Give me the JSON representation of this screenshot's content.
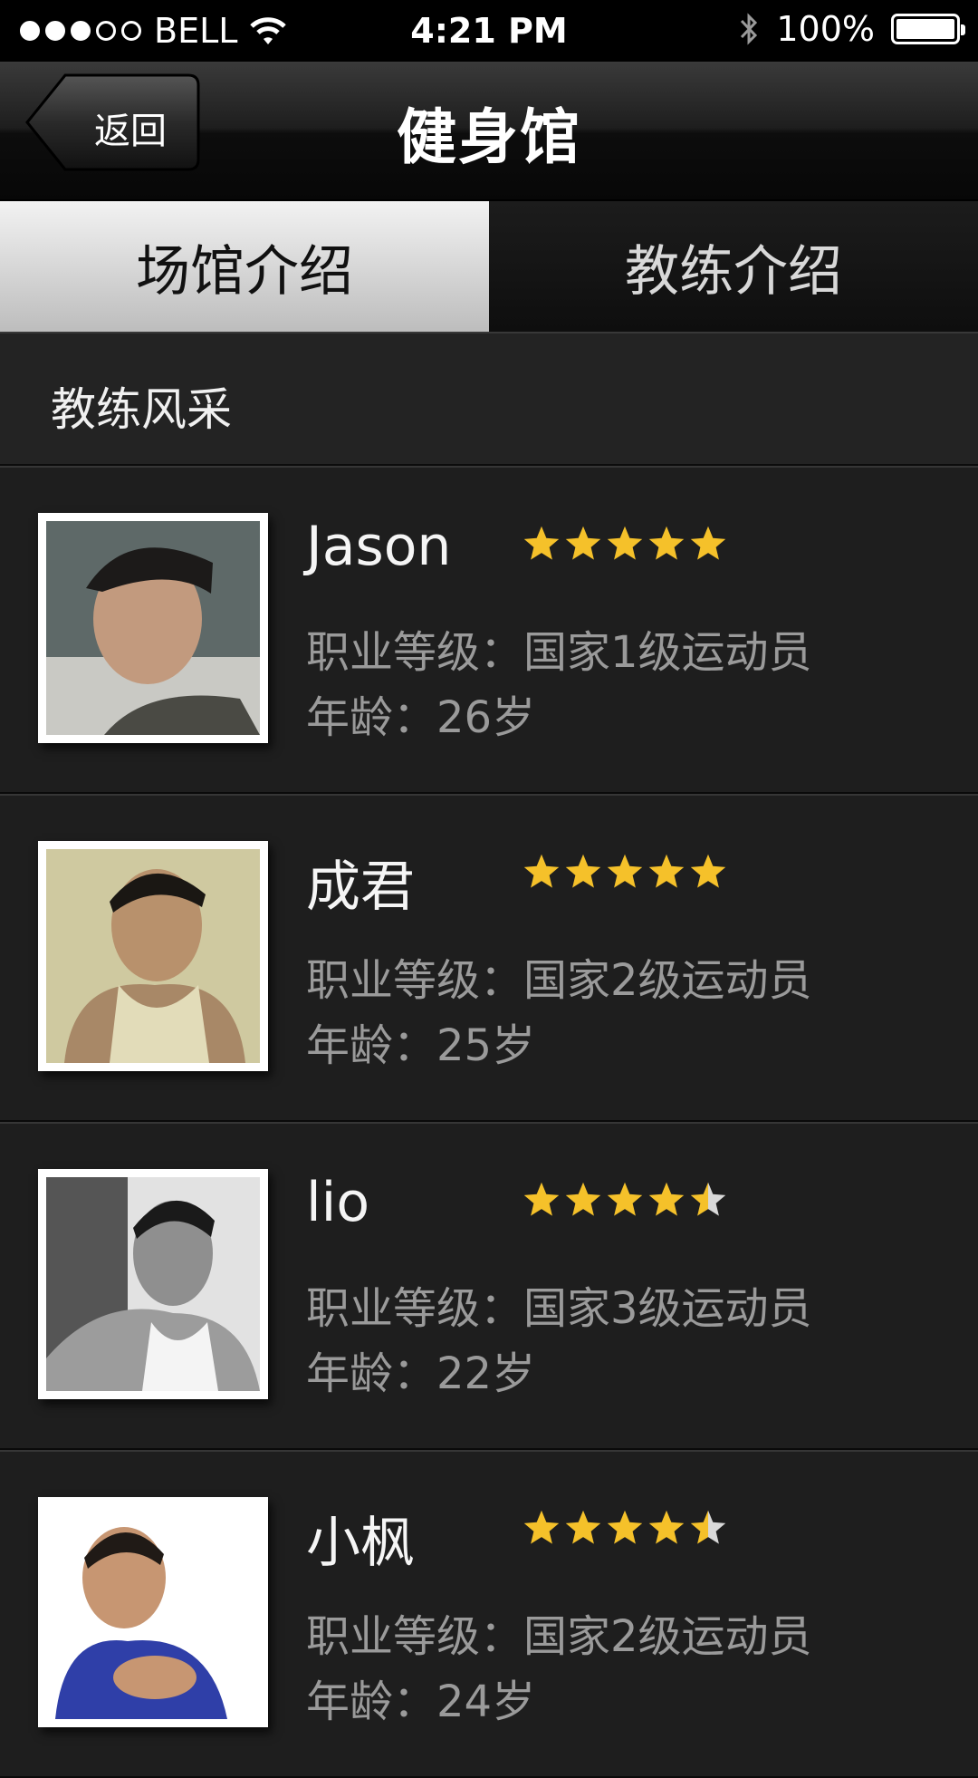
{
  "status_bar": {
    "carrier": "BELL",
    "time": "4:21 PM",
    "battery": "100%",
    "icons": [
      "signal-dots-icon",
      "wifi-icon",
      "bluetooth-icon",
      "battery-icon"
    ]
  },
  "nav": {
    "back_label": "返回",
    "title": "健身馆"
  },
  "tabs": [
    {
      "label": "场馆介绍",
      "active": true
    },
    {
      "label": "教练介绍",
      "active": false
    }
  ],
  "section": {
    "title": "教练风采"
  },
  "coaches": [
    {
      "name": "Jason",
      "rating": 5,
      "level": "职业等级：国家1级运动员",
      "age": "年龄：26岁"
    },
    {
      "name": "成君",
      "rating": 5,
      "level": "职业等级：国家2级运动员",
      "age": "年龄：25岁"
    },
    {
      "name": "lio",
      "rating": 4.5,
      "level": "职业等级：国家3级运动员",
      "age": "年龄：22岁"
    },
    {
      "name": "小枫",
      "rating": 4.5,
      "level": "职业等级：国家2级运动员",
      "age": "年龄：24岁"
    }
  ],
  "colors": {
    "background": "#1f1f1f",
    "star": "#f5c12a",
    "star_empty": "#d9d9d9",
    "muted_text": "#9a9a9a"
  }
}
